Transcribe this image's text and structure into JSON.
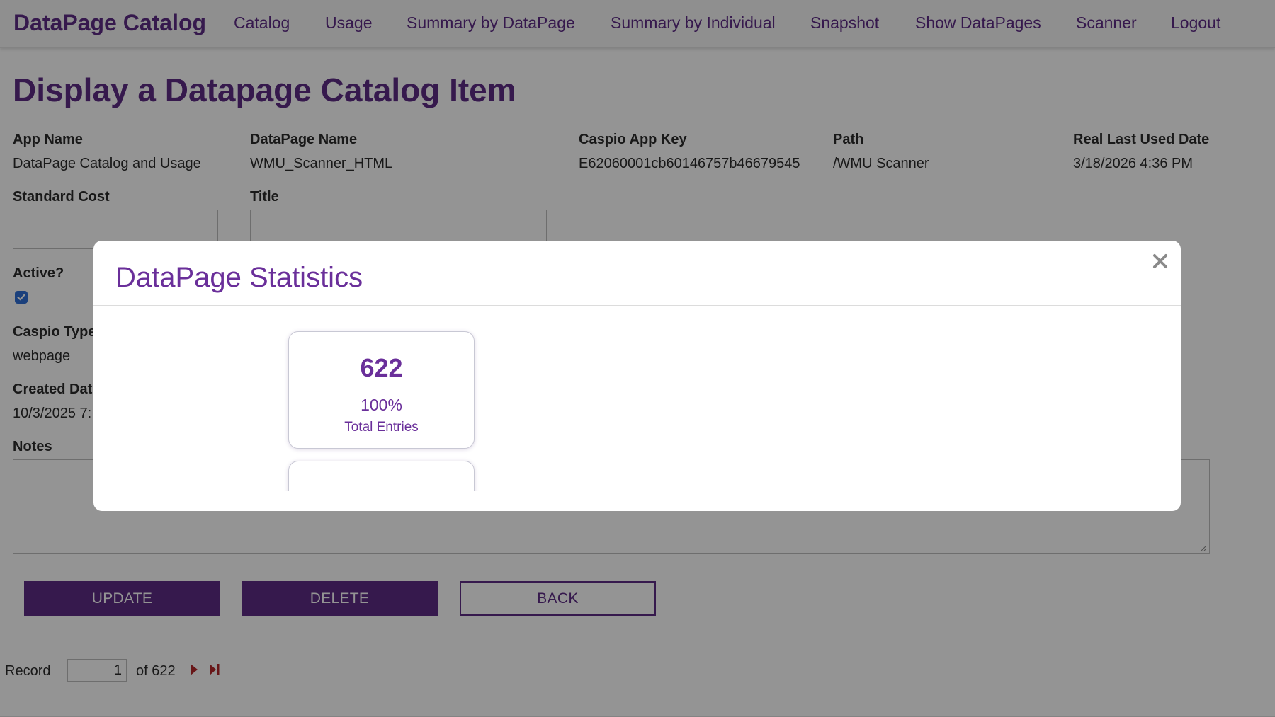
{
  "app": {
    "brand": "DataPage Catalog",
    "nav": [
      "Catalog",
      "Usage",
      "Summary by DataPage",
      "Summary by Individual",
      "Snapshot",
      "Show DataPages",
      "Scanner",
      "Logout"
    ]
  },
  "page": {
    "title": "Display a Datapage Catalog Item",
    "fields": {
      "app_name": {
        "label": "App Name",
        "value": "DataPage Catalog and Usage"
      },
      "datapage_name": {
        "label": "DataPage Name",
        "value": "WMU_Scanner_HTML"
      },
      "app_key": {
        "label": "Caspio App Key",
        "value": "E62060001cb60146757b46679545"
      },
      "path": {
        "label": "Path",
        "value": "/WMU Scanner"
      },
      "last_used": {
        "label": "Real Last Used Date",
        "value": "3/18/2026 4:36 PM"
      },
      "standard_cost": {
        "label": "Standard Cost",
        "value": ""
      },
      "title": {
        "label": "Title",
        "value": ""
      },
      "active": {
        "label": "Active?",
        "checked": true
      },
      "caspio_type": {
        "label": "Caspio Type",
        "value": "webpage"
      },
      "created_date": {
        "label": "Created Dat",
        "value": "10/3/2025 7:"
      },
      "notes": {
        "label": "Notes",
        "value": ""
      }
    },
    "buttons": {
      "update": "UPDATE",
      "delete": "DELETE",
      "back": "BACK"
    },
    "pager": {
      "record_label": "Record",
      "current": "1",
      "of_label": "of 622"
    }
  },
  "modal": {
    "title": "DataPage Statistics",
    "cards": [
      {
        "value": "622",
        "percent": "100%",
        "label": "Total Entries"
      }
    ]
  },
  "colors": {
    "accent": "#5e2c86",
    "modal_text": "#6a2f9a",
    "checkbox": "#2f6fd6",
    "pager_icon": "#b3262a"
  }
}
